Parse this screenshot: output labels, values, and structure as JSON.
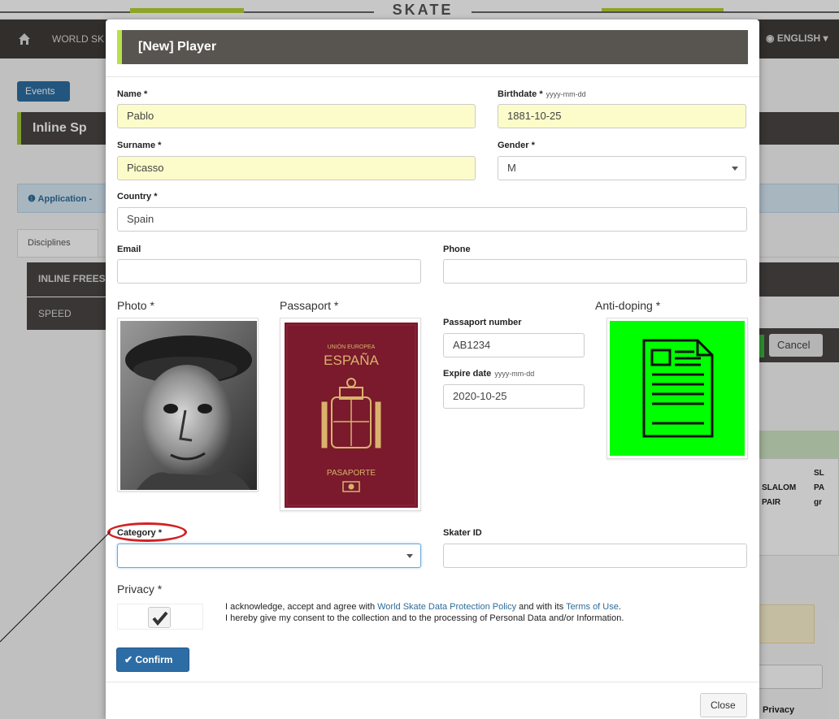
{
  "background": {
    "logo": "SKATE",
    "nav_label": "WORLD SK",
    "language": "ENGLISH",
    "events_button": "Events",
    "sport_title": "Inline Sp",
    "info_text": "Application -",
    "tab_disciplines": "Disciplines",
    "row_inline": "INLINE FREES",
    "row_speed": "SPEED",
    "cancel_button": "Cancel",
    "table_header_1": "SLALOM",
    "table_header_1b": "PAIR",
    "table_header_2": "SL",
    "table_header_2b": "PA",
    "table_header_2c": "gr",
    "privacy_label": "Privacy"
  },
  "modal": {
    "title": "[New] Player",
    "fields": {
      "name": {
        "label": "Name *",
        "value": "Pablo"
      },
      "birthdate": {
        "label": "Birthdate *",
        "hint": "yyyy-mm-dd",
        "value": "1881-10-25"
      },
      "surname": {
        "label": "Surname *",
        "value": "Picasso"
      },
      "gender": {
        "label": "Gender *",
        "value": "M"
      },
      "country": {
        "label": "Country *",
        "value": "Spain"
      },
      "email": {
        "label": "Email",
        "value": ""
      },
      "phone": {
        "label": "Phone",
        "value": ""
      },
      "passport_number": {
        "label": "Passaport number",
        "value": "AB1234"
      },
      "expire_date": {
        "label": "Expire date",
        "hint": "yyyy-mm-dd",
        "value": "2020-10-25"
      },
      "category": {
        "label": "Category *",
        "value": ""
      },
      "skater_id": {
        "label": "Skater ID",
        "value": ""
      }
    },
    "uploads": {
      "photo_label": "Photo *",
      "passport_label": "Passaport *",
      "antidoping_label": "Anti-doping *",
      "passport_cover_top": "UNIÓN EUROPEA",
      "passport_cover_country": "ESPAÑA",
      "passport_cover_bottom": "PASAPORTE"
    },
    "privacy": {
      "label": "Privacy *",
      "checked": true,
      "line1_prefix": "I acknowledge, accept and agree with ",
      "line1_link1": "World Skate Data Protection Policy",
      "line1_mid": " and with its ",
      "line1_link2": "Terms of Use",
      "line1_suffix": ".",
      "line2": "I hereby give my consent to the collection and to the processing of Personal Data and/or Information."
    },
    "confirm_button": "Confirm",
    "close_button": "Close"
  },
  "colors": {
    "header_bg": "#58544f",
    "header_accent": "#b7e04a",
    "required_input_bg": "#fbfcc9",
    "confirm_bg": "#2d6da5",
    "antidoping_bg": "#00ff00",
    "annotation": "#d42020",
    "link": "#2d6d9a"
  }
}
